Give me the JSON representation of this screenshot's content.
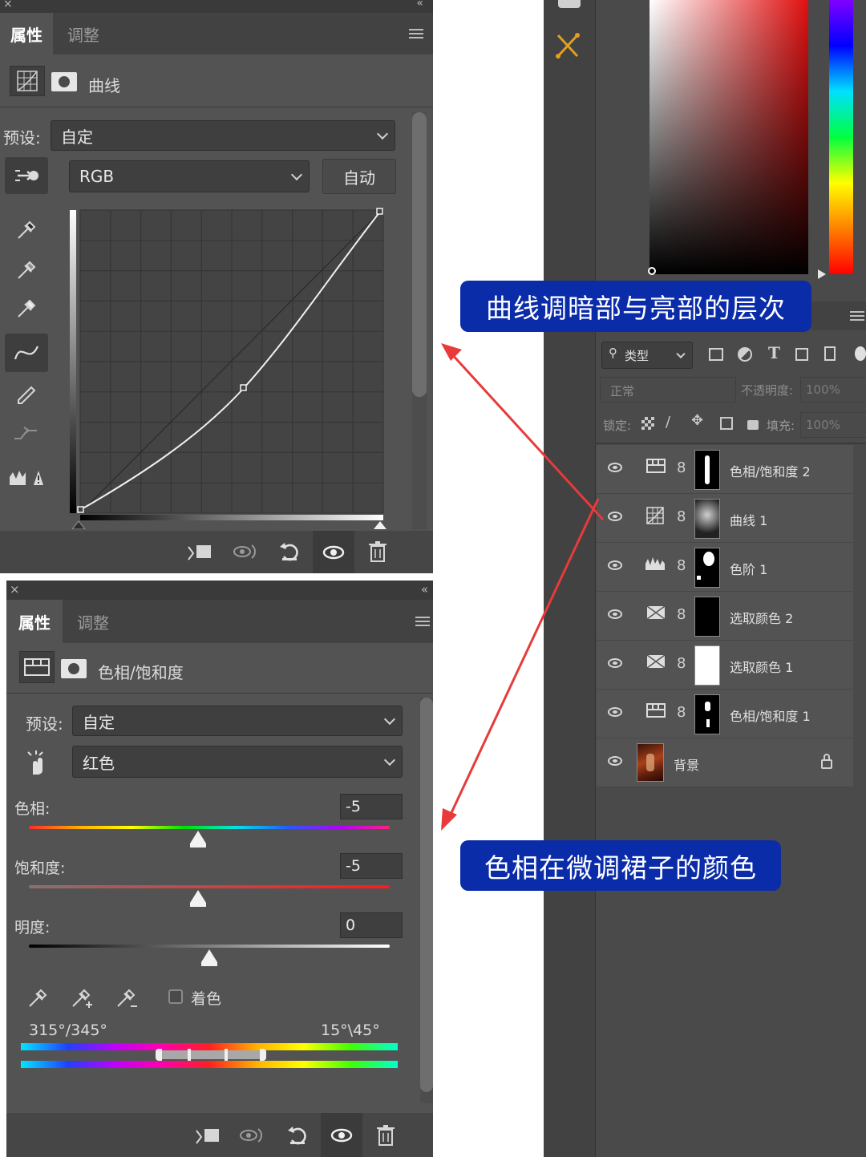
{
  "curves_panel": {
    "tabs": [
      "属性",
      "调整"
    ],
    "header_title": "曲线",
    "preset_label": "预设:",
    "preset_value": "自定",
    "channel_value": "RGB",
    "auto_button": "自动",
    "tools": [
      "sample-shadows-eyedropper-icon",
      "sample-midtones-eyedropper-icon",
      "sample-highlights-eyedropper-icon",
      "curve-point-icon",
      "pencil-icon",
      "smooth-icon",
      "clipping-warning-icon"
    ],
    "bottom_icons": [
      "clip-to-layer-icon",
      "view-previous-icon",
      "reset-icon",
      "visibility-icon",
      "delete-icon"
    ]
  },
  "hue_sat_panel": {
    "tabs": [
      "属性",
      "调整"
    ],
    "header_title": "色相/饱和度",
    "preset_label": "预设:",
    "preset_value": "自定",
    "range_value": "红色",
    "hue_label": "色相:",
    "hue_value": "-5",
    "hue_level": -5,
    "saturation_label": "饱和度:",
    "saturation_value": "-5",
    "saturation_level": -5,
    "lightness_label": "明度:",
    "lightness_value": "0",
    "lightness_level": 0,
    "colorize_label": "着色",
    "range_left": "315°/345°",
    "range_right": "15°\\45°",
    "bottom_icons": [
      "clip-to-layer-icon",
      "view-previous-icon",
      "reset-icon",
      "visibility-icon",
      "delete-icon"
    ]
  },
  "layers_panel": {
    "filter_label": "类型",
    "blend_mode": "正常",
    "opacity_label": "不透明度:",
    "opacity_value": "100%",
    "lock_label": "锁定:",
    "fill_label": "填充:",
    "fill_value": "100%",
    "layers": [
      {
        "name": "色相/饱和度 2",
        "icon": "hue-sat-icon"
      },
      {
        "name": "曲线 1",
        "icon": "curves-icon"
      },
      {
        "name": "色阶 1",
        "icon": "levels-icon"
      },
      {
        "name": "选取颜色 2",
        "icon": "selective-color-icon"
      },
      {
        "name": "选取颜色 1",
        "icon": "selective-color-icon"
      },
      {
        "name": "色相/饱和度 1",
        "icon": "hue-sat-icon"
      },
      {
        "name": "背景",
        "icon": "lock-icon"
      }
    ]
  },
  "callouts": {
    "top": "曲线调暗部与亮部的层次",
    "bottom": "色相在微调裙子的颜色"
  },
  "colors": {
    "callout_bg": "#0b2ca8",
    "arrow": "#e83a3a",
    "panel_bg": "#535353"
  }
}
